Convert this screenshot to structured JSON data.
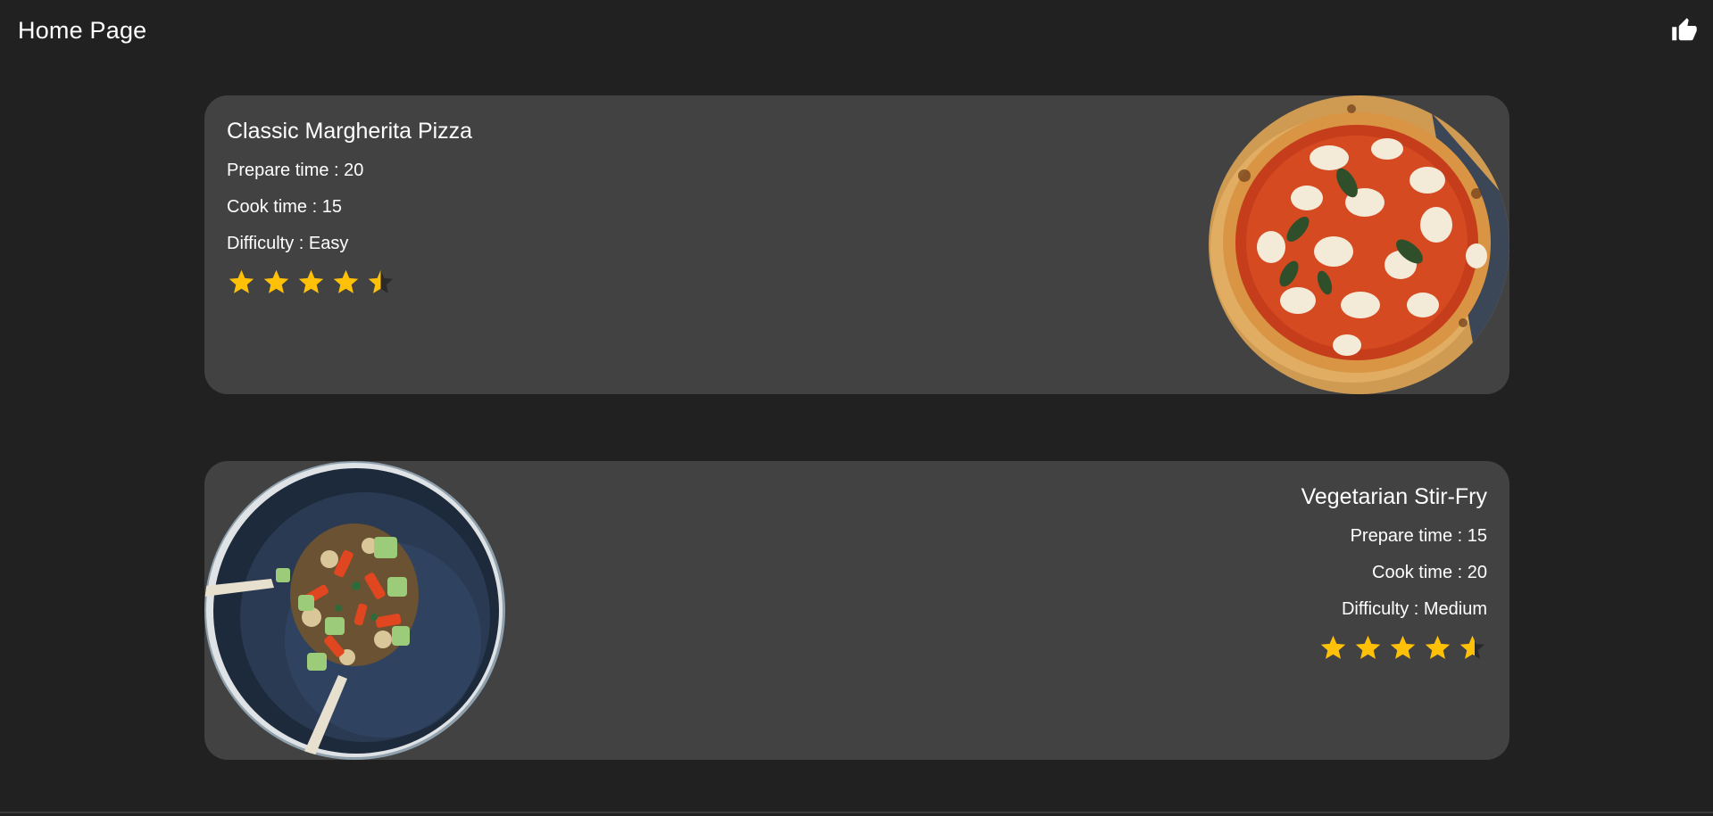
{
  "appbar": {
    "title": "Home Page",
    "action_icon": "thumb-up-icon"
  },
  "colors": {
    "background": "#212121",
    "card": "#424242",
    "star": "#FFC107",
    "star_empty": "#2a2a2a"
  },
  "recipes": [
    {
      "title": "Classic Margherita Pizza",
      "prepare_time": "Prepare time : 20",
      "cook_time": "Cook time : 15",
      "difficulty": "Difficulty : Easy",
      "rating": 4.5,
      "rating_max": 5,
      "image_icon": "margherita-pizza-photo"
    },
    {
      "title": "Vegetarian Stir-Fry",
      "prepare_time": "Prepare time : 15",
      "cook_time": "Cook time : 20",
      "difficulty": "Difficulty : Medium",
      "rating": 4.6,
      "rating_max": 5,
      "image_icon": "stir-fry-bowl-photo"
    }
  ]
}
